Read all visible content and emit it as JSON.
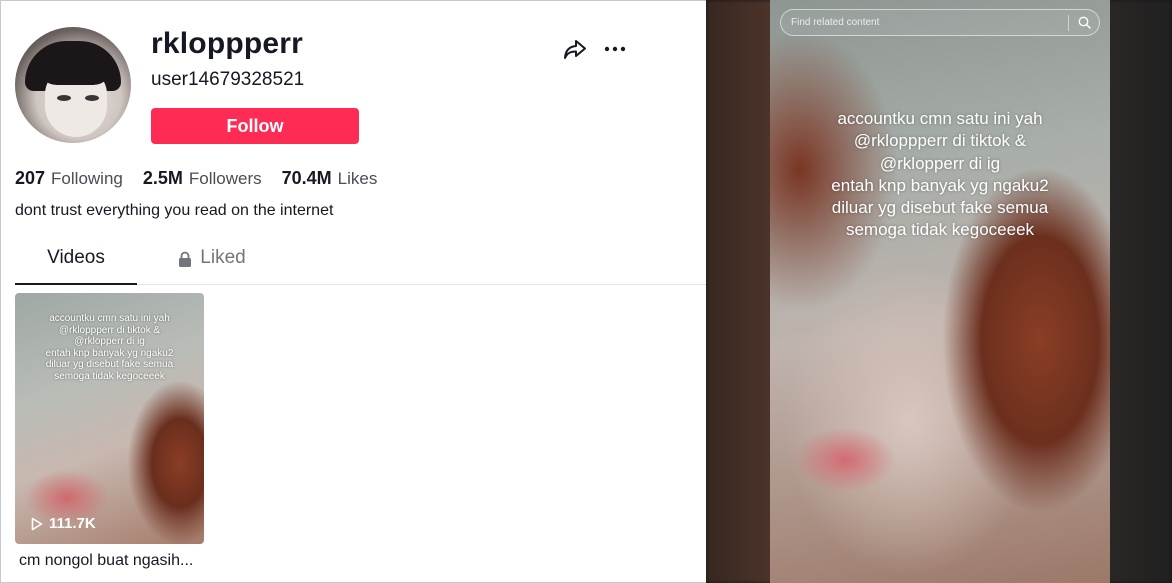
{
  "profile": {
    "username": "rkloppperr",
    "handle": "user14679328521",
    "follow_label": "Follow",
    "stats": [
      {
        "value": "207",
        "label": "Following"
      },
      {
        "value": "2.5M",
        "label": "Followers"
      },
      {
        "value": "70.4M",
        "label": "Likes"
      }
    ],
    "bio": "dont trust everything you read on the internet",
    "icons": {
      "share": "share-icon",
      "more": "more-icon"
    }
  },
  "tabs": {
    "videos": "Videos",
    "liked": "Liked"
  },
  "videos": [
    {
      "overlay": "accountku cmn satu ini yah\n@rkloppperr di tiktok &\n@rklopperr di ig\nentah knp banyak yg ngaku2\ndiluar yg disebut fake semua\nsemoga tidak kegoceeek",
      "views": "111.7K",
      "caption": "cm nongol buat ngasih..."
    }
  ],
  "player": {
    "search_placeholder": "Find related content",
    "overlay_text": "accountku cmn satu ini yah\n@rkloppperr di tiktok &\n@rklopperr di ig\nentah knp banyak yg ngaku2\ndiluar yg disebut fake semua\nsemoga tidak kegoceeek"
  },
  "colors": {
    "accent": "#fe2c55",
    "text": "#161823",
    "muted": "#73757c"
  }
}
